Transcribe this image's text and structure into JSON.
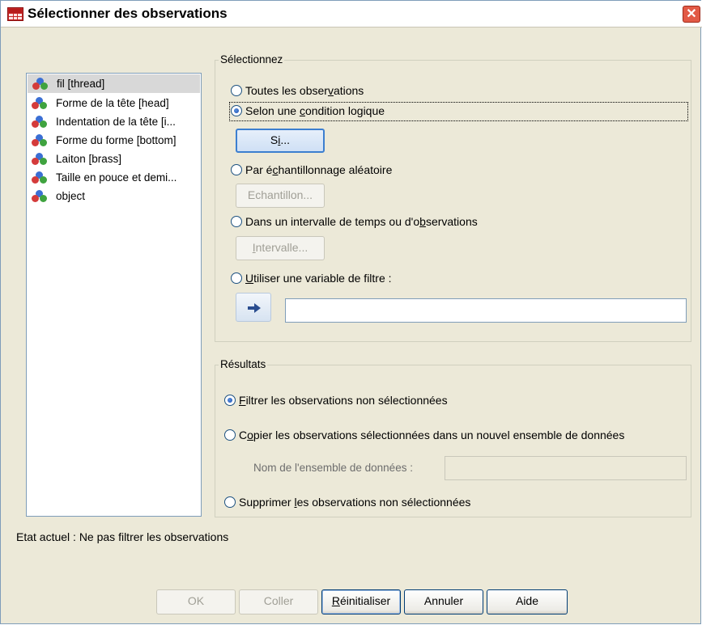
{
  "window": {
    "title": "Sélectionner des observations",
    "close_glyph": "✕"
  },
  "variables": [
    {
      "label": "fil [thread]",
      "icon": "nominal-variable-icon",
      "selected": true
    },
    {
      "label": "Forme de la tête [head]",
      "icon": "nominal-variable-icon"
    },
    {
      "label": "Indentation de la tête [i...",
      "icon": "nominal-variable-icon"
    },
    {
      "label": "Forme du forme [bottom]",
      "icon": "nominal-variable-icon"
    },
    {
      "label": "Laiton [brass]",
      "icon": "nominal-variable-icon"
    },
    {
      "label": "Taille en pouce et demi...",
      "icon": "nominal-variable-icon"
    },
    {
      "label": "object",
      "icon": "nominal-variable-icon"
    }
  ],
  "select_group": {
    "legend": "Sélectionnez",
    "options": {
      "all": {
        "label_pre": "Toutes les obser",
        "label_u": "v",
        "label_post": "ations",
        "checked": false
      },
      "condition": {
        "label_pre": "Selon une ",
        "label_u": "c",
        "label_post": "ondition logique",
        "checked": true
      },
      "random": {
        "label_pre": "Par é",
        "label_u": "c",
        "label_post": "hantillonnage aléatoire",
        "checked": false
      },
      "range": {
        "label_pre": "Dans un intervalle de temps ou d'o",
        "label_u": "b",
        "label_post": "servations",
        "checked": false
      },
      "filter": {
        "label_pre": "",
        "label_u": "U",
        "label_post": "tiliser une variable de filtre :",
        "checked": false
      }
    },
    "if_button": {
      "label_pre": "S",
      "label_u": "i",
      "label_post": "..."
    },
    "sample_button": {
      "label": "Echantillon..."
    },
    "range_button": {
      "label_pre": "",
      "label_u": "I",
      "label_post": "ntervalle..."
    },
    "filter_variable_value": ""
  },
  "output_group": {
    "legend": "Résultats",
    "options": {
      "filter": {
        "label_pre": "",
        "label_u": "F",
        "label_post": "iltrer les observations non sélectionnées",
        "checked": true
      },
      "copy": {
        "label_pre": "C",
        "label_u": "o",
        "label_post": "pier les observations sélectionnées dans un nouvel ensemble de données",
        "checked": false
      },
      "delete": {
        "label_pre": "Supprimer ",
        "label_u": "l",
        "label_post": "es observations non sélectionnées",
        "checked": false
      }
    },
    "dataset_name_label": "Nom de l'ensemble de données :",
    "dataset_name_value": ""
  },
  "status_text": "Etat actuel : Ne pas filtrer les observations",
  "buttons": {
    "ok": "OK",
    "paste": "Coller",
    "reset_pre": "",
    "reset_u": "R",
    "reset_post": "éinitialiser",
    "cancel": "Annuler",
    "help": "Aide"
  }
}
